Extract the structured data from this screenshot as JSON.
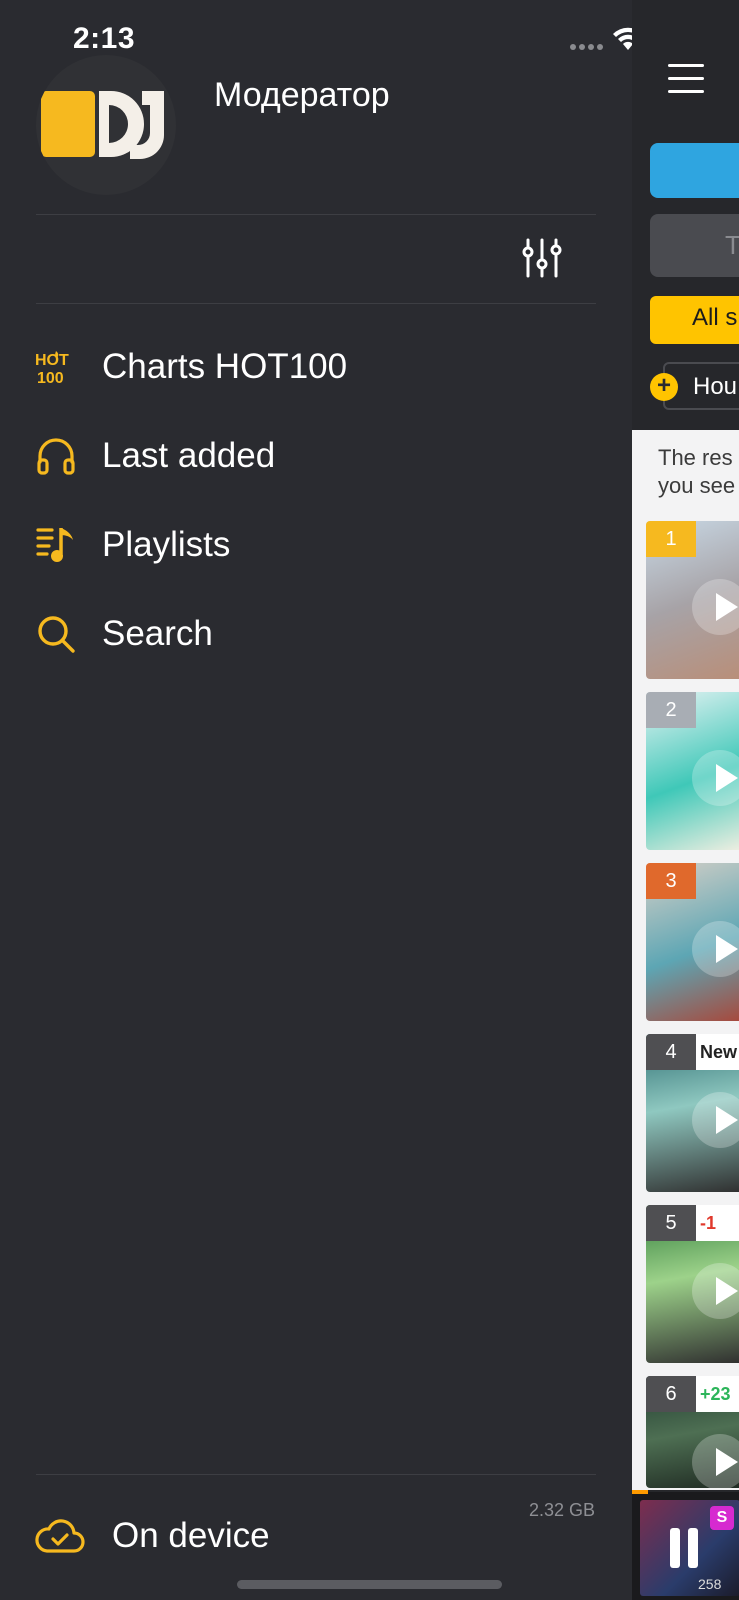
{
  "status_bar": {
    "time": "2:13"
  },
  "drawer": {
    "username": "Модератор",
    "menu": [
      {
        "label": "Charts HOT100",
        "icon": "hot100-icon"
      },
      {
        "label": "Last added",
        "icon": "headphones-icon"
      },
      {
        "label": "Playlists",
        "icon": "playlist-icon"
      },
      {
        "label": "Search",
        "icon": "search-icon"
      }
    ],
    "storage": "2.32 GB",
    "on_device_label": "On device"
  },
  "background_page": {
    "grey_button_partial": "T",
    "yellow_button_partial": "All s",
    "genre_chip_partial": "Hou",
    "note_partial": [
      "The res",
      "you see"
    ],
    "tracks": [
      {
        "rank": "1",
        "delta": ""
      },
      {
        "rank": "2",
        "delta": ""
      },
      {
        "rank": "3",
        "delta": ""
      },
      {
        "rank": "4",
        "delta": "New"
      },
      {
        "rank": "5",
        "delta": "-1"
      },
      {
        "rank": "6",
        "delta": "+23"
      }
    ],
    "mini_player_count": "258"
  },
  "colors": {
    "accent": "#f6b91f",
    "background": "#2a2b30",
    "blue": "#2fa5e0",
    "yellow": "#ffc400"
  }
}
